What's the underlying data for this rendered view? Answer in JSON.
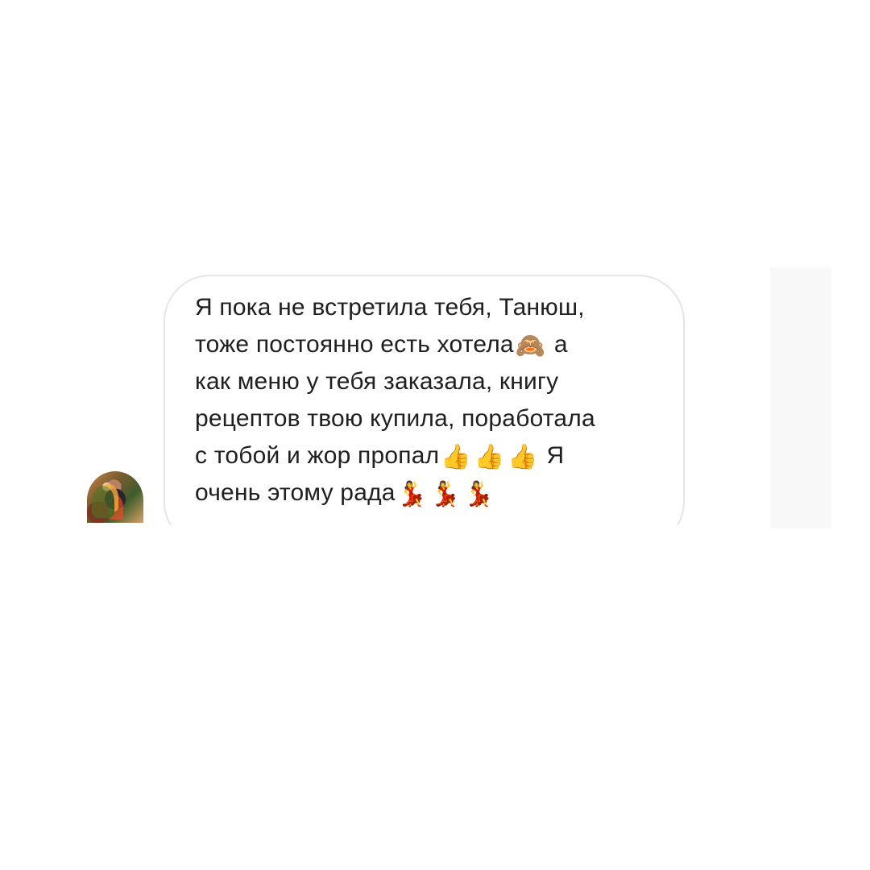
{
  "message": {
    "line1": "Я пока не встретила тебя, Танюш,",
    "line2_text": "тоже постоянно есть хотела",
    "line2_emoji": "🙈",
    "line2_tail": " а",
    "line3": "как меню у тебя заказала, книгу",
    "line4": "рецептов твою купила, поработала",
    "line5_text": "с тобой и жор пропал",
    "line5_emojis": [
      "👍",
      "👍",
      "👍"
    ],
    "line5_tail": " Я",
    "line6_text": "очень этому рада",
    "line6_emojis": [
      "💃",
      "💃",
      "💃"
    ]
  },
  "avatar": {
    "icon": "profile-photo-avatar"
  },
  "colors": {
    "background": "#ffffff",
    "bubble_border": "#e5e5e5",
    "text": "#202020",
    "side_strip": "#f8f8f8"
  }
}
